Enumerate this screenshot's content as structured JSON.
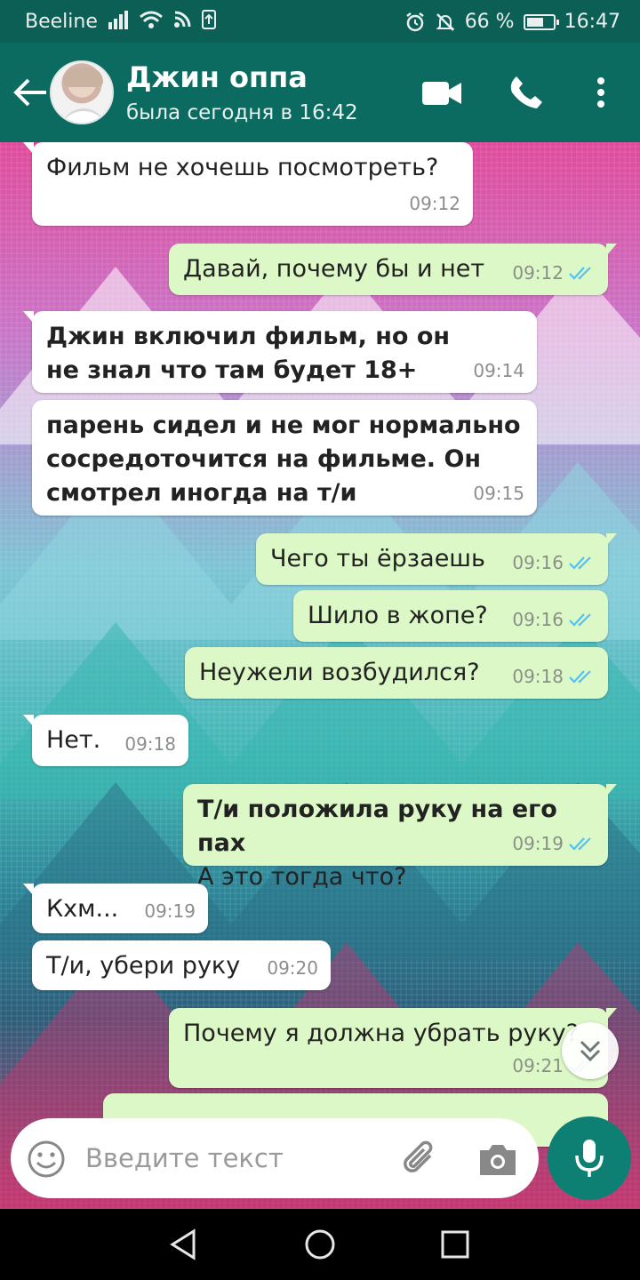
{
  "status_bar": {
    "carrier": "Beeline",
    "battery": "66 %",
    "battery_level": 0.66,
    "time": "16:47"
  },
  "header": {
    "contact_name": "Джин оппа",
    "last_seen": "была сегодня в 16:42",
    "icons": [
      "back-arrow-icon",
      "video-call-icon",
      "phone-icon",
      "more-vertical-icon"
    ]
  },
  "messages": [
    {
      "direction": "in",
      "text": "Фильм не хочешь посмотреть?",
      "time": "09:12"
    },
    {
      "direction": "out",
      "text": "Давай, почему бы и нет",
      "time": "09:12",
      "read": true
    },
    {
      "direction": "in",
      "text": "Джин включил фильм, но он не знал что там будет 18+",
      "time": "09:14",
      "bold": true
    },
    {
      "direction": "in",
      "text": "парень сидел и не мог нормально сосредоточится на фильме. Он смотрел иногда на т/и",
      "time": "09:15",
      "bold": true
    },
    {
      "direction": "out",
      "text": "Чего ты ёрзаешь",
      "time": "09:16",
      "read": true
    },
    {
      "direction": "out",
      "text": "Шило в жопе?",
      "time": "09:16",
      "read": true
    },
    {
      "direction": "out",
      "text": "Неужели возбудился?",
      "time": "09:18",
      "read": true
    },
    {
      "direction": "in",
      "text": "Нет.",
      "time": "09:18"
    },
    {
      "direction": "out",
      "text_bold": "Т/и положила руку на его пах",
      "text": "А это тогда что?",
      "time": "09:19",
      "read": true
    },
    {
      "direction": "in",
      "text": "Кхм...",
      "time": "09:19"
    },
    {
      "direction": "in",
      "text": "Т/и, убери руку",
      "time": "09:20"
    },
    {
      "direction": "out",
      "text": "Почему я должна убрать руку?",
      "time": "09:21",
      "read": true
    }
  ],
  "composer": {
    "placeholder": "Введите текст"
  },
  "colors": {
    "header": "#0b6b60",
    "status_bar": "#0b5f55",
    "outgoing_bubble": "#dcf8c6",
    "incoming_bubble": "#ffffff",
    "read_ticks": "#4fc3f7",
    "mic_button": "#0d7f73"
  }
}
